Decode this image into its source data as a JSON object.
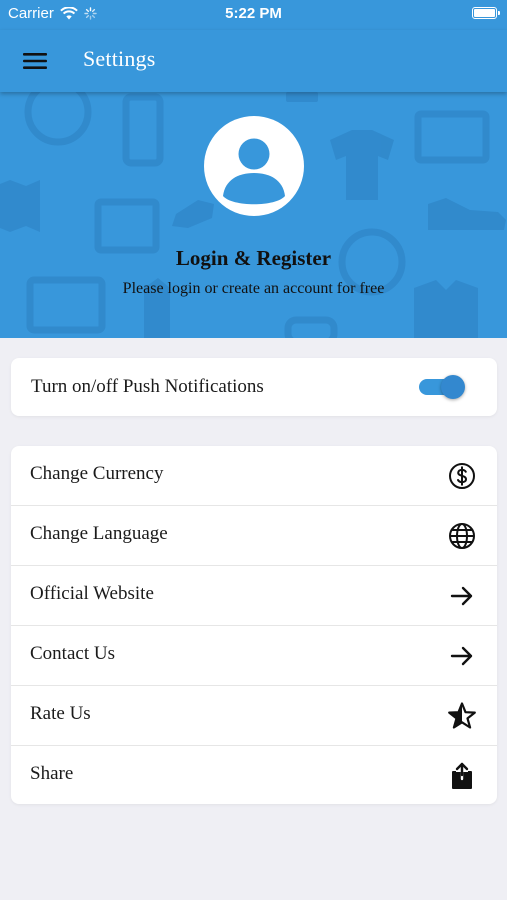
{
  "status_bar": {
    "carrier": "Carrier",
    "time": "5:22 PM"
  },
  "app_bar": {
    "title": "Settings",
    "menu_icon": "hamburger-menu-icon"
  },
  "profile": {
    "title": "Login & Register",
    "subtitle": "Please login or create an account for free",
    "avatar_icon": "user-avatar-icon"
  },
  "push_notifications": {
    "label": "Turn on/off Push Notifications",
    "enabled": true
  },
  "menu": {
    "items": [
      {
        "label": "Change Currency",
        "icon": "dollar-circle-icon"
      },
      {
        "label": "Change Language",
        "icon": "globe-icon"
      },
      {
        "label": "Official Website",
        "icon": "arrow-right-icon"
      },
      {
        "label": "Contact Us",
        "icon": "arrow-right-icon"
      },
      {
        "label": "Rate Us",
        "icon": "star-outline-icon"
      },
      {
        "label": "Share",
        "icon": "share-icon"
      }
    ]
  },
  "colors": {
    "primary": "#3897DB",
    "background": "#EFEFF4",
    "card": "#FFFFFF",
    "text": "#1B1B1B"
  }
}
